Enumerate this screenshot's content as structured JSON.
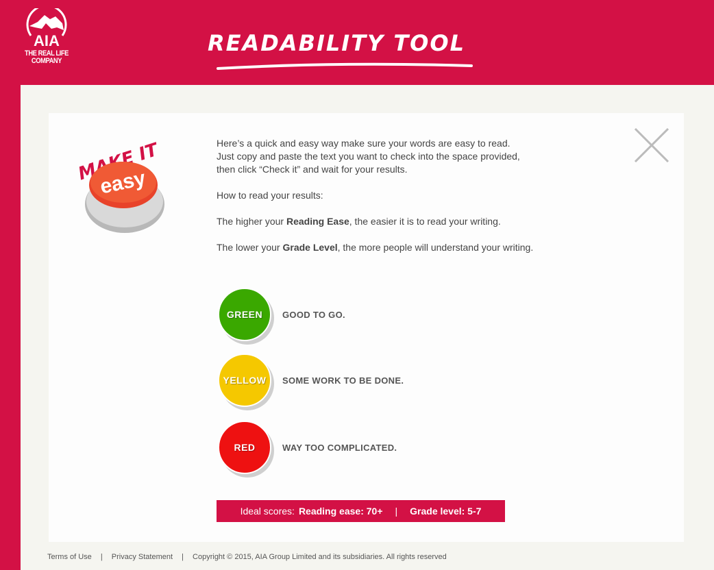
{
  "header": {
    "logo_text": "AIA",
    "tagline_1": "THE REAL LIFE",
    "tagline_2": "COMPANY",
    "title": "READABILITY TOOL"
  },
  "hero": {
    "make_it": "MAKE IT",
    "button_text": "easy"
  },
  "intro": {
    "p1_l1": "Here’s a quick and easy way make sure your words are easy to read.",
    "p1_l2": "Just copy and paste the text you want to check into the space provided,",
    "p1_l3": "then click “Check it” and wait for your results.",
    "p2": "How to read your results:",
    "p3_a": "The higher your ",
    "p3_b": "Reading Ease",
    "p3_c": ", the easier it is to read your writing.",
    "p4_a": "The lower your ",
    "p4_b": "Grade Level",
    "p4_c": ", the more people will understand your writing."
  },
  "legend": [
    {
      "label": "GREEN",
      "text": "GOOD TO GO.",
      "color": "#3aa800"
    },
    {
      "label": "YELLOW",
      "text": "SOME WORK TO BE DONE.",
      "color": "#f5c800"
    },
    {
      "label": "RED",
      "text": "WAY TOO COMPLICATED.",
      "color": "#ee1111"
    }
  ],
  "ideal": {
    "prefix": "Ideal scores:",
    "ease": "Reading ease: 70+",
    "sep": "|",
    "grade": "Grade level: 5-7"
  },
  "footer": {
    "terms": "Terms of Use",
    "sep": "|",
    "privacy": "Privacy Statement",
    "copyright": "Copyright © 2015, AIA Group Limited and its subsidiaries. All rights reserved"
  },
  "colors": {
    "brand": "#d31145"
  }
}
